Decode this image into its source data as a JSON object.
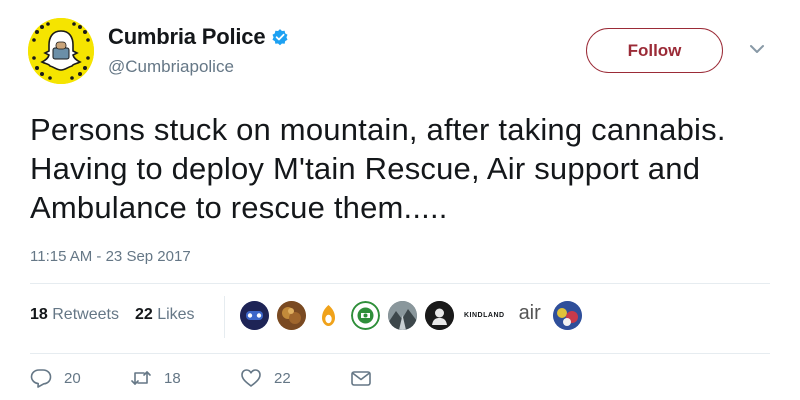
{
  "header": {
    "display_name": "Cumbria Police",
    "handle": "@Cumbriapolice",
    "follow_label": "Follow"
  },
  "tweet": {
    "text": "Persons stuck on mountain, after taking cannabis. Having to deploy M'tain Rescue, Air support and Ambulance to rescue them.....",
    "timestamp": "11:15 AM - 23 Sep 2017"
  },
  "stats": {
    "retweets_count": "18",
    "retweets_label": "Retweets",
    "likes_count": "22",
    "likes_label": "Likes"
  },
  "likers": [
    {
      "name": "liker-avatar-1",
      "color": "#2b2f6b"
    },
    {
      "name": "liker-avatar-2",
      "color": "#8a5a2a"
    },
    {
      "name": "liker-avatar-3",
      "color": "#f0a21a"
    },
    {
      "name": "liker-avatar-4",
      "color": "#2f8f3a"
    },
    {
      "name": "liker-avatar-5",
      "color": "#5b6a70"
    },
    {
      "name": "liker-avatar-6",
      "color": "#1c1c1c"
    },
    {
      "name": "liker-avatar-7",
      "text": "KINDLAND"
    },
    {
      "name": "liker-avatar-8",
      "text": "air"
    },
    {
      "name": "liker-avatar-9",
      "color": "#3b5aa8"
    }
  ],
  "actions": {
    "reply_count": "20",
    "retweet_count": "18",
    "like_count": "22"
  },
  "colors": {
    "follow_accent": "#9b2b37",
    "verified_blue": "#1da1f2",
    "secondary_text": "#657786",
    "avatar_yellow": "#f5e400"
  },
  "icons": {
    "verified": "verified-badge-icon",
    "caret": "chevron-down-icon",
    "reply": "reply-icon",
    "retweet": "retweet-icon",
    "like": "heart-icon",
    "message": "direct-message-icon"
  }
}
